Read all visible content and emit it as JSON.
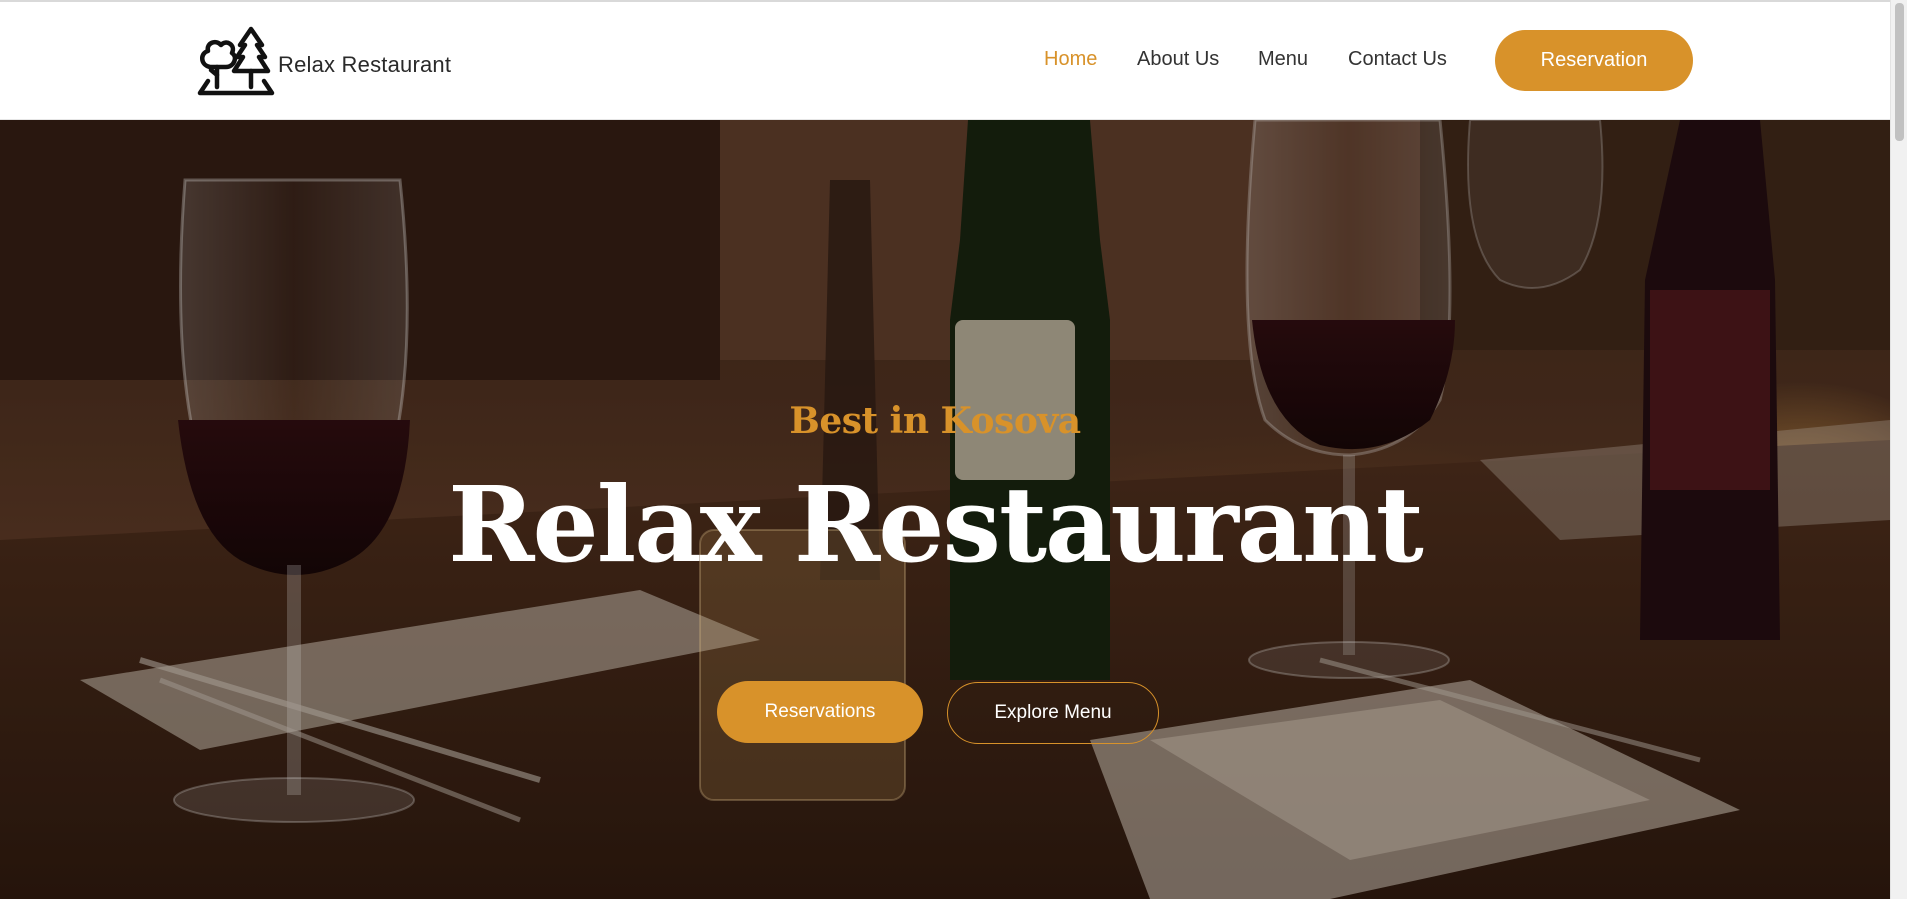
{
  "brand": {
    "name": "Relax Restaurant",
    "logo_icon": "trees-icon"
  },
  "nav": {
    "items": [
      {
        "label": "Home",
        "active": true
      },
      {
        "label": "About Us",
        "active": false
      },
      {
        "label": "Menu",
        "active": false
      },
      {
        "label": "Contact Us",
        "active": false
      }
    ],
    "cta_label": "Reservation"
  },
  "hero": {
    "eyebrow": "Best in Kosova",
    "title": "Relax Restaurant",
    "primary_button": "Reservations",
    "secondary_button": "Explore Menu",
    "background": "restaurant table with wine glasses and bottles"
  },
  "colors": {
    "accent": "#d8922a",
    "text_dark": "#333333",
    "hero_text": "#ffffff"
  }
}
